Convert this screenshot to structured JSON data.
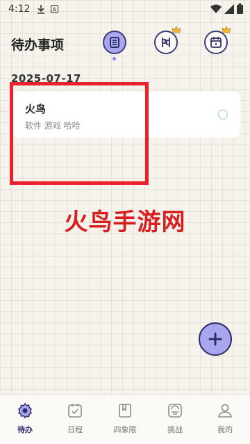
{
  "status_bar": {
    "time": "4:12",
    "left_icons": [
      "download-icon",
      "a-badge-icon"
    ],
    "right_icons": [
      "wifi-icon",
      "signal-icon",
      "battery-icon"
    ]
  },
  "header": {
    "title": "待办事项",
    "buttons": [
      {
        "name": "list-view",
        "icon": "list-icon",
        "active": true
      },
      {
        "name": "kanban-view",
        "icon": "kanban-icon",
        "active": false,
        "crown": true
      },
      {
        "name": "calendar-view",
        "icon": "calendar-icon",
        "active": false,
        "crown": true
      }
    ]
  },
  "date": "2025-07-17",
  "tasks": [
    {
      "title": "火鸟",
      "subtitle": "软件 游戏 哈哈",
      "done": false
    }
  ],
  "watermark": "火鸟手游网",
  "fab": {
    "icon": "plus-icon"
  },
  "tabbar": {
    "items": [
      {
        "label": "待办",
        "icon": "todo-gear-icon",
        "active": true
      },
      {
        "label": "日程",
        "icon": "schedule-icon",
        "active": false
      },
      {
        "label": "四象限",
        "icon": "quadrant-icon",
        "active": false
      },
      {
        "label": "挑战",
        "icon": "challenge-icon",
        "active": false
      },
      {
        "label": "我的",
        "icon": "profile-icon",
        "active": false
      }
    ]
  },
  "colors": {
    "accent": "#a9a6f0",
    "dark": "#2f2c6a",
    "highlight_red": "#e8212b",
    "background": "#f5f3ec"
  }
}
